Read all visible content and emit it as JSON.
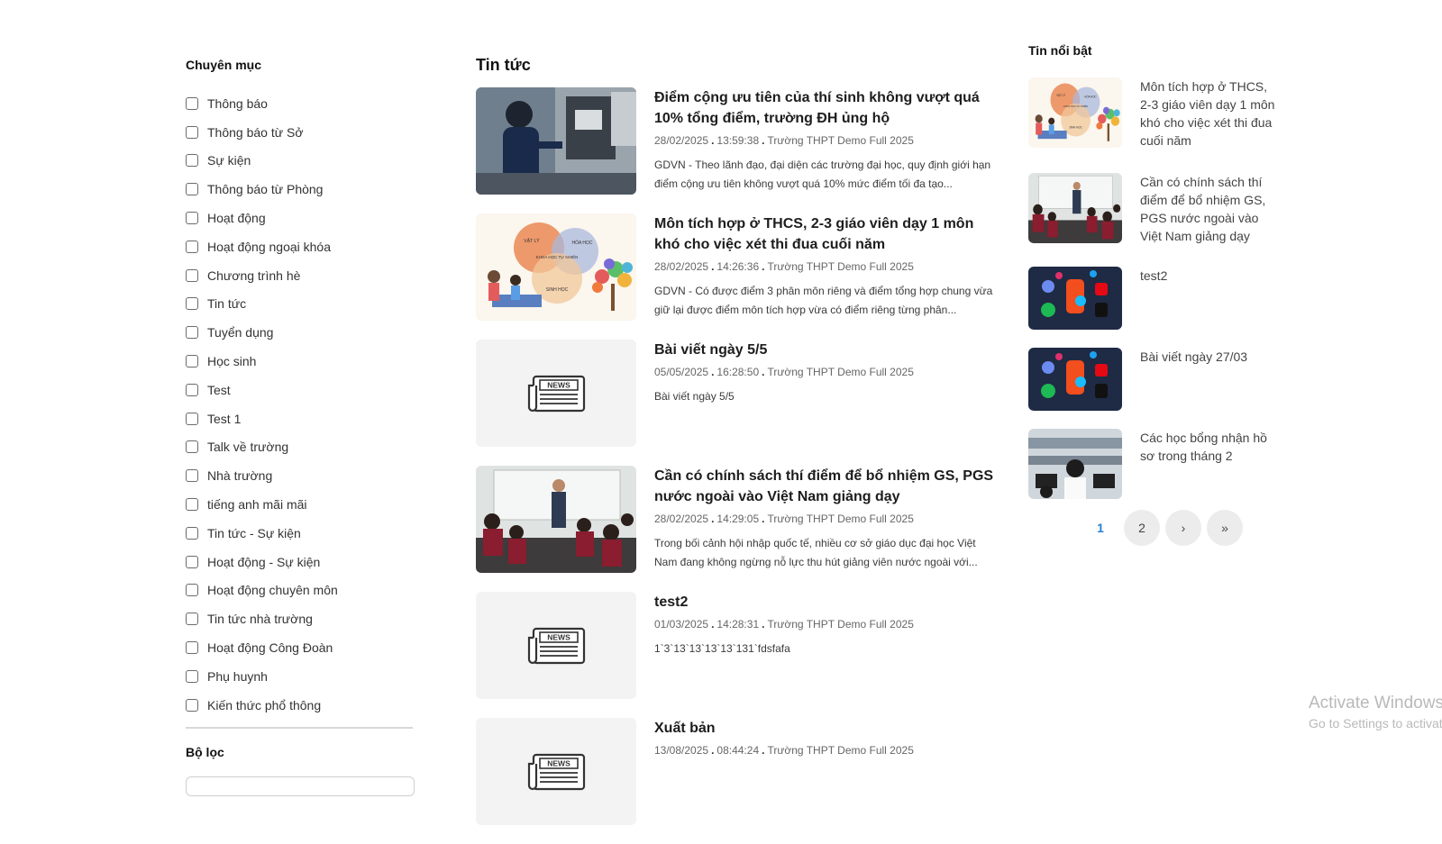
{
  "sidebar": {
    "heading": "Chuyên mục",
    "categories": [
      "Thông báo",
      "Thông báo từ Sở",
      "Sự kiện",
      "Thông báo từ Phòng",
      "Hoạt động",
      "Hoạt động ngoại khóa",
      "Chương trình hè",
      "Tin tức",
      "Tuyển dụng",
      "Học sinh",
      "Test",
      "Test 1",
      "Talk về trường",
      "Nhà trường",
      "tiếng anh mãi mãi",
      "Tin tức - Sự kiện",
      "Hoạt động - Sự kiện",
      "Hoạt động chuyên môn",
      "Tin tức nhà trường",
      "Hoạt động Công Đoàn",
      "Phụ huynh",
      "Kiến thức phổ thông"
    ],
    "filter_heading": "Bộ lọc"
  },
  "main": {
    "title": "Tin tức",
    "news": [
      {
        "title": "Điểm cộng ưu tiên của thí sinh không vượt quá 10% tổng điểm, trường ĐH ủng hộ",
        "date": "28/02/2025",
        "time": "13:59:38",
        "source": "Trường THPT Demo Full 2025",
        "desc": "GDVN - Theo lãnh đạo, đại diện các trường đại học, quy định giới hạn điểm cộng ưu tiên không vượt quá 10% mức điểm tối đa tạo..."
      },
      {
        "title": "Môn tích hợp ở THCS, 2-3 giáo viên dạy 1 môn khó cho việc xét thi đua cuối năm",
        "date": "28/02/2025",
        "time": "14:26:36",
        "source": "Trường THPT Demo Full 2025",
        "desc": "GDVN - Có được điểm 3 phân môn riêng và điểm tổng hợp chung vừa giữ lại được điểm môn tích hợp vừa có điểm riêng từng phân..."
      },
      {
        "title": "Bài viết ngày 5/5",
        "date": "05/05/2025",
        "time": "16:28:50",
        "source": "Trường THPT Demo Full 2025",
        "desc": "Bài viết ngày 5/5"
      },
      {
        "title": "Cần có chính sách thí điểm để bổ nhiệm GS, PGS nước ngoài vào Việt Nam giảng dạy",
        "date": "28/02/2025",
        "time": "14:29:05",
        "source": "Trường THPT Demo Full 2025",
        "desc": "Trong bối cảnh hội nhập quốc tế, nhiều cơ sở giáo dục đại học Việt Nam đang không ngừng nỗ lực thu hút giảng viên nước ngoài với..."
      },
      {
        "title": "test2",
        "date": "01/03/2025",
        "time": "14:28:31",
        "source": "Trường THPT Demo Full 2025",
        "desc": "1`3`13`13`13`13`131`fdsfafa"
      },
      {
        "title": "Xuất bản",
        "date": "13/08/2025",
        "time": "08:44:24",
        "source": "Trường THPT Demo Full 2025",
        "desc": ""
      }
    ]
  },
  "right": {
    "title": "Tin nổi bật",
    "items": [
      "Môn tích hợp ở THCS, 2-3 giáo viên dạy 1 môn khó cho việc xét thi đua cuối năm",
      "Cần có chính sách thí điểm để bổ nhiệm GS, PGS nước ngoài vào Việt Nam giảng dạy",
      "test2",
      "Bài viết ngày 27/03",
      "Các học bổng nhận hồ sơ trong tháng 2"
    ],
    "pagination": {
      "pages": [
        "1",
        "2"
      ],
      "next": "›",
      "last": "»"
    }
  },
  "news_placeholder_label": "NEWS",
  "venn_labels": {
    "left": "VẬT LÝ",
    "right": "HÓA HỌC",
    "center": "KHOA HỌC TỰ NHIÊN",
    "bottom": "SINH HỌC"
  },
  "watermark": {
    "line1": "Activate Windows",
    "line2": "Go to Settings to activate Windows."
  },
  "colors": {
    "accent": "#2a7fd4",
    "placeholder_bg": "#f3f3f4"
  }
}
